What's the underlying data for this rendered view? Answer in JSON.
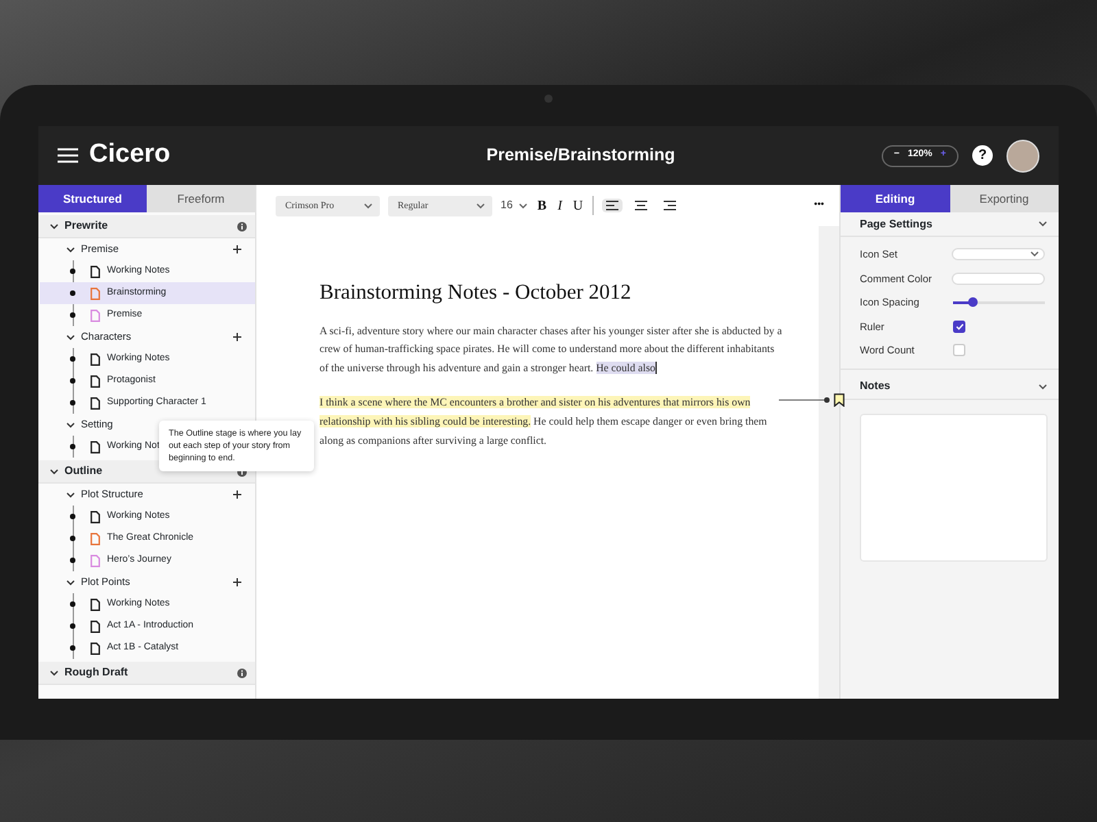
{
  "header": {
    "logo": "Cicero",
    "title": "Premise/Brainstorming",
    "zoom": {
      "minus": "−",
      "value": "120%",
      "plus": "+"
    },
    "help": "?"
  },
  "sidebar": {
    "tabs": [
      {
        "label": "Structured",
        "selected": true
      },
      {
        "label": "Freeform",
        "selected": false
      }
    ],
    "tooltip": "The Outline stage is where you lay out each step of your story from beginning to end.",
    "sections": [
      {
        "title": "Prewrite",
        "expanded": true,
        "groups": [
          {
            "title": "Premise",
            "expanded": true,
            "items": [
              {
                "label": "Working Notes",
                "color": "#222222",
                "selected": false
              },
              {
                "label": "Brainstorming",
                "color": "#e8743b",
                "selected": true
              },
              {
                "label": "Premise",
                "color": "#d98be0",
                "selected": false
              }
            ]
          },
          {
            "title": "Characters",
            "expanded": true,
            "items": [
              {
                "label": "Working Notes",
                "color": "#222222",
                "selected": false
              },
              {
                "label": "Protagonist",
                "color": "#222222",
                "selected": false
              },
              {
                "label": "Supporting Character 1",
                "color": "#222222",
                "selected": false
              }
            ]
          },
          {
            "title": "Setting",
            "expanded": true,
            "items": [
              {
                "label": "Working Not",
                "color": "#222222",
                "selected": false
              }
            ]
          }
        ]
      },
      {
        "title": "Outline",
        "expanded": true,
        "groups": [
          {
            "title": "Plot Structure",
            "expanded": true,
            "items": [
              {
                "label": "Working Notes",
                "color": "#222222",
                "selected": false
              },
              {
                "label": "The Great Chronicle",
                "color": "#e8743b",
                "selected": false
              },
              {
                "label": "Hero’s Journey",
                "color": "#d98be0",
                "selected": false
              }
            ]
          },
          {
            "title": "Plot Points",
            "expanded": true,
            "items": [
              {
                "label": "Working Notes",
                "color": "#222222",
                "selected": false
              },
              {
                "label": "Act 1A - Introduction",
                "color": "#222222",
                "selected": false
              },
              {
                "label": "Act 1B - Catalyst",
                "color": "#222222",
                "selected": false
              }
            ]
          }
        ]
      },
      {
        "title": "Rough Draft",
        "expanded": true
      }
    ]
  },
  "editor": {
    "toolbar": {
      "font": "Crimson Pro",
      "weight": "Regular",
      "size": "16",
      "styles": [
        "B",
        "I",
        "U"
      ],
      "alignments": [
        {
          "selected": true
        },
        {
          "selected": false
        },
        {
          "selected": false
        }
      ],
      "more": "•••"
    },
    "title": "Brainstorming Notes - October 2012",
    "paragraphs": [
      {
        "comment": false,
        "segments": [
          {
            "kind": "plain",
            "text": "A sci-fi, adventure story where our main character chases after his younger sister after she is abducted by a crew of human-trafficking space pirates. He will come to understand more about the different inhabitants of the universe through his adventure and gain a stronger heart. "
          },
          {
            "kind": "selected",
            "text": "He could also"
          }
        ]
      },
      {
        "comment": true,
        "segments": [
          {
            "kind": "highlight",
            "text": "I think a scene where the MC encounters a brother and sister on his adventures that mirrors his own relationship with his sibling could be interesting."
          },
          {
            "kind": "plain",
            "text": " He could help them escape danger or even bring them along as companions after surviving a large conflict."
          }
        ]
      }
    ]
  },
  "panel": {
    "tabs": [
      {
        "label": "Editing",
        "selected": true
      },
      {
        "label": "Exporting",
        "selected": false
      }
    ],
    "settings": {
      "title": "Page Settings",
      "expanded": true,
      "rows": [
        {
          "label": "Icon Set",
          "kind": "select"
        },
        {
          "label": "Comment Color",
          "kind": "text"
        },
        {
          "label": "Icon Spacing",
          "kind": "slider",
          "level": 0.22
        },
        {
          "label": "Ruler",
          "kind": "checkbox",
          "checked": true
        },
        {
          "label": "Word Count",
          "kind": "checkbox",
          "checked": false
        }
      ]
    },
    "notes": {
      "title": "Notes",
      "expanded": true
    }
  }
}
